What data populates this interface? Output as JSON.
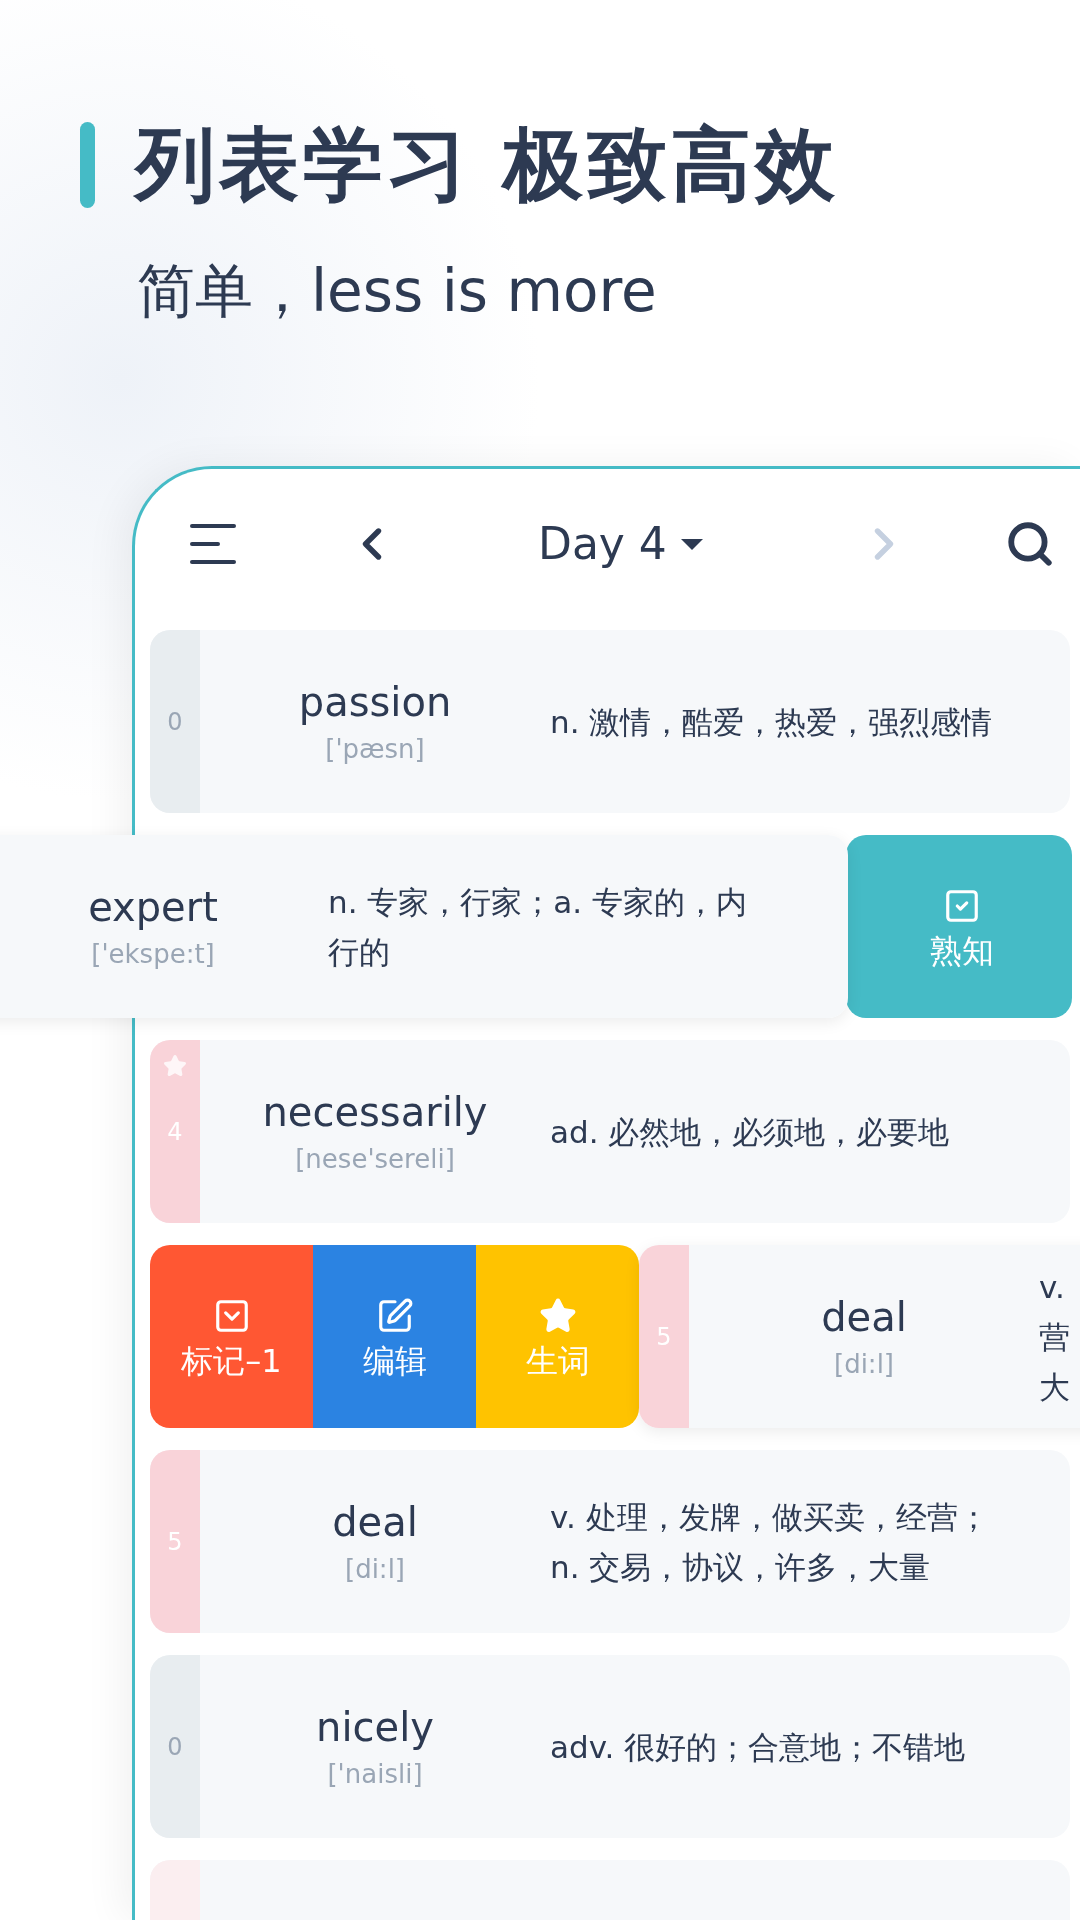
{
  "headline": {
    "title": "列表学习 极致高效",
    "subtitle": "简单，less is more"
  },
  "toolbar": {
    "title": "Day 4",
    "next_disabled": true
  },
  "rows": [
    {
      "kind": "plain",
      "word": "passion",
      "phonetic": "['pæsn]",
      "definition": [
        "n. 激情，酷爱，热爱，强烈感情"
      ],
      "count": "0",
      "color": "#e8edf0",
      "starred": false
    },
    {
      "kind": "swiped_left",
      "word": "expert",
      "phonetic": "['ekspe:t]",
      "definition": [
        "n. 专家，行家；a. 专家的，内行的"
      ],
      "actions": [
        {
          "kind": "known",
          "label": "熟知"
        }
      ]
    },
    {
      "kind": "plain",
      "word": "necessarily",
      "phonetic": "[nese'sereli]",
      "definition": [
        "ad. 必然地，必须地，必要地"
      ],
      "count": "4",
      "color": "#f9d3d9",
      "starred": true
    },
    {
      "kind": "swiped_right",
      "word": "deal",
      "phonetic": "[di:l]",
      "definition": [
        "v.",
        "营",
        "大"
      ],
      "count": "5",
      "color": "#f9d3d9",
      "starred": false,
      "actions": [
        {
          "kind": "mark",
          "label": "标记–1"
        },
        {
          "kind": "edit",
          "label": "编辑"
        },
        {
          "kind": "star",
          "label": "生词"
        }
      ]
    },
    {
      "kind": "plain",
      "word": "deal",
      "phonetic": "[di:l]",
      "definition": [
        "v. 处理，发牌，做买卖，经营；n. 交易，协议，许多，大量"
      ],
      "count": "5",
      "color": "#f9d3d9",
      "starred": false
    },
    {
      "kind": "plain",
      "word": "nicely",
      "phonetic": "['naisli]",
      "definition": [
        "adv. 很好的；合意地；不错地"
      ],
      "count": "0",
      "color": "#e8edf0",
      "starred": false
    },
    {
      "kind": "plain",
      "color": "#fbeef0",
      "starred": false
    }
  ]
}
